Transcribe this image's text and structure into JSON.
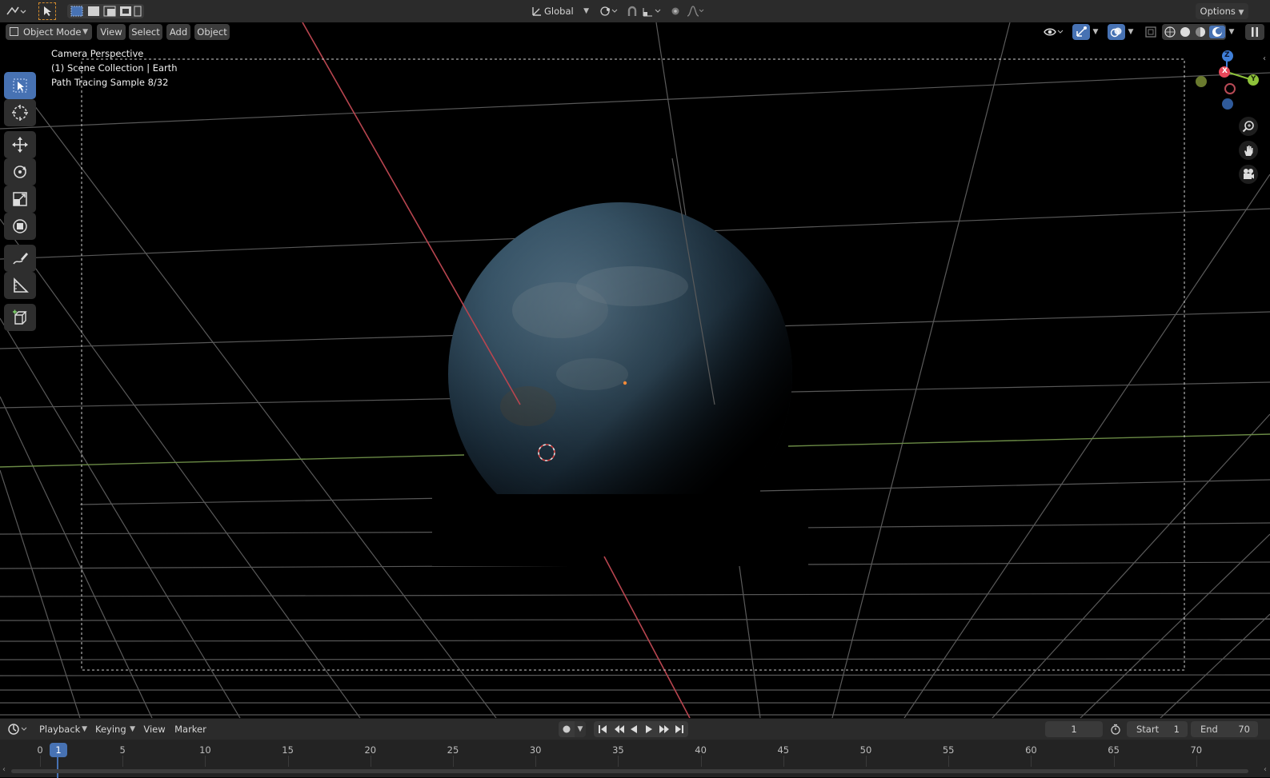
{
  "top_header": {
    "transform_orientation": "Global",
    "options_label": "Options"
  },
  "viewport_header": {
    "mode_label": "Object Mode",
    "menus": [
      "View",
      "Select",
      "Add",
      "Object"
    ]
  },
  "viewport_overlay": {
    "camera_label": "Camera Perspective",
    "collection_label": "(1) Scene Collection | Earth",
    "render_status": "Path Tracing Sample 8/32"
  },
  "gizmo": {
    "z_label": "Z",
    "x_label": "X",
    "y_label": "Y"
  },
  "timeline": {
    "menus": [
      "Playback",
      "Keying",
      "View",
      "Marker"
    ],
    "current_frame": "1",
    "start_label": "Start",
    "start_value": "1",
    "end_label": "End",
    "end_value": "70",
    "ruler_labels": [
      "0",
      "5",
      "10",
      "15",
      "20",
      "25",
      "30",
      "35",
      "40",
      "45",
      "50",
      "55",
      "60",
      "65",
      "70"
    ],
    "playhead_value": "1"
  },
  "colors": {
    "accent": "#4772b3",
    "x_axis": "#d44a5a",
    "y_axis": "#8ec23a",
    "z_axis": "#3f7fd8",
    "grid": "#5a5a5a"
  }
}
